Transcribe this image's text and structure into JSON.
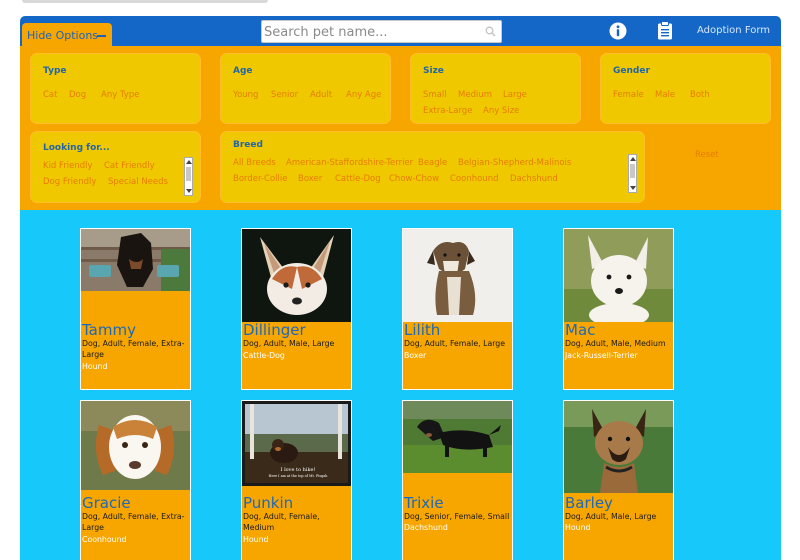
{
  "header": {
    "hide_options_label": "Hide Options",
    "search_placeholder": "Search pet name...",
    "adoption_form_label": "Adoption Form",
    "icons": [
      "minus-icon",
      "search-icon",
      "info-icon",
      "clipboard-icon"
    ]
  },
  "filters": {
    "type": {
      "title": "Type",
      "options": [
        "Cat",
        "Dog",
        "Any Type"
      ]
    },
    "age": {
      "title": "Age",
      "options": [
        "Young",
        "Senior",
        "Adult",
        "Any Age"
      ]
    },
    "size": {
      "title": "Size",
      "options": [
        "Small",
        "Medium",
        "Large",
        "Extra-Large",
        "Any Size"
      ]
    },
    "gender": {
      "title": "Gender",
      "options": [
        "Female",
        "Male",
        "Both"
      ]
    },
    "looking": {
      "title": "Looking for...",
      "options": [
        "Kid Friendly",
        "Cat Friendly",
        "Dog Friendly",
        "Special Needs"
      ]
    },
    "breed": {
      "title": "Breed",
      "options": [
        "All Breeds",
        "American-Staffordshire-Terrier",
        "Beagle",
        "Belgian-Shepherd-Malinois",
        "Border-Collie",
        "Boxer",
        "Cattle-Dog",
        "Chow-Chow",
        "Coonhound",
        "Dachshund"
      ]
    },
    "reset_label": "Reset"
  },
  "pets": [
    {
      "name": "Tammy",
      "tags": "Dog, Adult, Female, Extra-Large",
      "breed": "Hound"
    },
    {
      "name": "Dillinger",
      "tags": "Dog, Adult, Male, Large",
      "breed": "Cattle-Dog"
    },
    {
      "name": "Lilith",
      "tags": "Dog, Adult, Female, Large",
      "breed": "Boxer"
    },
    {
      "name": "Mac",
      "tags": "Dog, Adult, Male, Medium",
      "breed": "Jack-Russell-Terrier"
    },
    {
      "name": "Gracie",
      "tags": "Dog, Adult, Female, Extra-Large",
      "breed": "Coonhound"
    },
    {
      "name": "Punkin",
      "tags": "Dog, Adult, Female, Medium",
      "breed": "Hound",
      "photo_caption_1": "I love to hike!",
      "photo_caption_2": "Here I am at the top of Mt. Pisgah"
    },
    {
      "name": "Trixie",
      "tags": "Dog, Senior, Female, Small",
      "breed": "Dachshund"
    },
    {
      "name": "Barley",
      "tags": "Dog, Adult, Male, Large",
      "breed": "Hound"
    }
  ],
  "colors": {
    "header_blue": "#1467c6",
    "panel_orange": "#f7a600",
    "filter_box_yellow": "#efc800",
    "results_cyan": "#16c9fa",
    "name_blue": "#1c68ba",
    "option_orange": "#e67d00"
  }
}
